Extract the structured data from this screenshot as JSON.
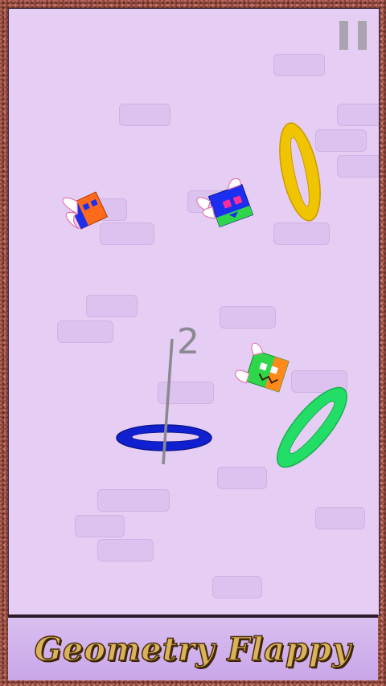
{
  "game": {
    "title": "Geometry Flappy",
    "score": "2"
  },
  "colors": {
    "background": "#e6cdf4",
    "frame": "#8d463a",
    "ring_yellow": "#f0c400",
    "ring_blue": "#1020d0",
    "ring_green": "#22dd66",
    "bird_orange": "#ff6a1a",
    "bird_blue": "#1c2ef0",
    "bird_green": "#2fd64a"
  },
  "icons": {
    "pause": "pause-icon",
    "wing": "wing-icon"
  }
}
